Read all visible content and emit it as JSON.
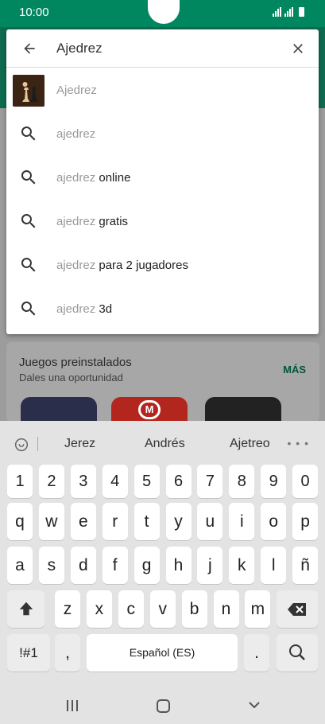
{
  "status_bar": {
    "time": "10:00"
  },
  "background": {
    "card_title": "Juegos preinstalados",
    "card_subtitle": "Dales una oportunidad",
    "card_more": "MÁS"
  },
  "search": {
    "query": "Ajedrez",
    "suggestions": [
      {
        "query": "Ajedrez",
        "rest": "",
        "type": "app"
      },
      {
        "query": "ajedrez",
        "rest": "",
        "type": "search"
      },
      {
        "query": "ajedrez",
        "rest": " online",
        "type": "search"
      },
      {
        "query": "ajedrez",
        "rest": " gratis",
        "type": "search"
      },
      {
        "query": "ajedrez",
        "rest": " para 2 jugadores",
        "type": "search"
      },
      {
        "query": "ajedrez",
        "rest": " 3d",
        "type": "search"
      }
    ]
  },
  "keyboard": {
    "word_suggestions": [
      "Jerez",
      "Andrés",
      "Ajetreo"
    ],
    "number_row": [
      "1",
      "2",
      "3",
      "4",
      "5",
      "6",
      "7",
      "8",
      "9",
      "0"
    ],
    "row1": [
      "q",
      "w",
      "e",
      "r",
      "t",
      "y",
      "u",
      "i",
      "o",
      "p"
    ],
    "row2": [
      "a",
      "s",
      "d",
      "f",
      "g",
      "h",
      "j",
      "k",
      "l",
      "ñ"
    ],
    "row3": [
      "z",
      "x",
      "c",
      "v",
      "b",
      "n",
      "m"
    ],
    "symbols_key": "!#1",
    "comma_key": ",",
    "space_label": "Español (ES)",
    "period_key": "."
  },
  "colors": {
    "brand_green": "#01875f",
    "keyboard_bg": "#e3e3e3"
  }
}
